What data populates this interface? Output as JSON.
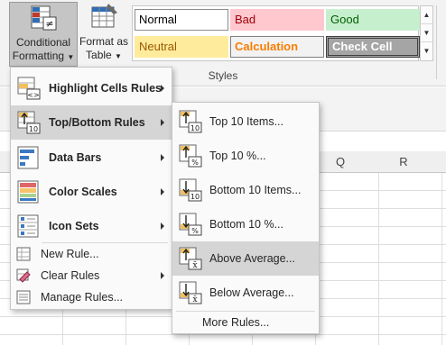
{
  "ribbon": {
    "conditional_formatting": {
      "line1": "Conditional",
      "line2": "Formatting"
    },
    "format_as_table": {
      "line1": "Format as",
      "line2": "Table"
    },
    "styles": {
      "normal": "Normal",
      "bad": "Bad",
      "good": "Good",
      "neutral": "Neutral",
      "calculation": "Calculation",
      "check_cell": "Check Cell"
    },
    "group_label": "Styles"
  },
  "sheet": {
    "columns": [
      "Q",
      "R"
    ]
  },
  "cf_menu": {
    "items": [
      {
        "label": "Highlight Cells Rules",
        "icon": "highlight-cells-icon",
        "submenu": true
      },
      {
        "label": "Top/Bottom Rules",
        "icon": "top-bottom-icon",
        "submenu": true,
        "selected": true
      },
      {
        "label": "Data Bars",
        "icon": "data-bars-icon",
        "submenu": true
      },
      {
        "label": "Color Scales",
        "icon": "color-scales-icon",
        "submenu": true
      },
      {
        "label": "Icon Sets",
        "icon": "icon-sets-icon",
        "submenu": true
      }
    ],
    "small_items": [
      {
        "label": "New Rule...",
        "icon": "new-rule-icon",
        "submenu": false
      },
      {
        "label": "Clear Rules",
        "icon": "clear-rules-icon",
        "submenu": true
      },
      {
        "label": "Manage Rules...",
        "icon": "manage-rules-icon",
        "submenu": false
      }
    ]
  },
  "top_bottom_menu": {
    "items": [
      {
        "label": "Top 10 Items...",
        "icon": "top-10-items-icon"
      },
      {
        "label": "Top 10 %...",
        "icon": "top-10-percent-icon"
      },
      {
        "label": "Bottom 10 Items...",
        "icon": "bottom-10-items-icon"
      },
      {
        "label": "Bottom 10 %...",
        "icon": "bottom-10-percent-icon"
      },
      {
        "label": "Above Average...",
        "icon": "above-average-icon",
        "selected": true
      },
      {
        "label": "Below Average...",
        "icon": "below-average-icon"
      }
    ],
    "more_rules": "More Rules..."
  },
  "colors": {
    "bad_bg": "#ffc7ce",
    "bad_fg": "#9c0006",
    "good_bg": "#c6efce",
    "good_fg": "#006100",
    "neutral_bg": "#ffeb9c",
    "neutral_fg": "#9c5700",
    "calc_bg": "#f2f2f2",
    "calc_fg": "#fa7d00",
    "check_bg": "#a5a5a5",
    "check_fg": "#ffffff"
  }
}
